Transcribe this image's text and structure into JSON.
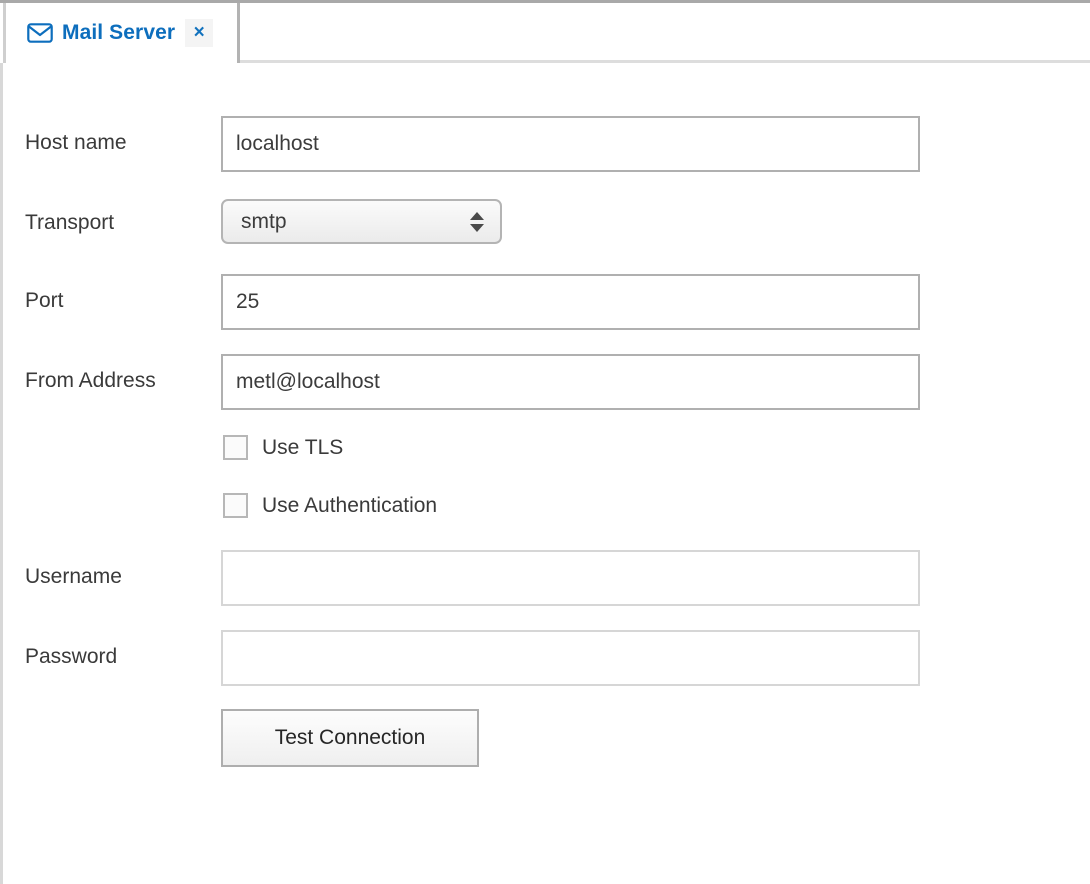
{
  "window": {
    "tab": {
      "icon": "envelope-icon",
      "title": "Mail Server",
      "close_label": "×"
    }
  },
  "form": {
    "fields": [
      {
        "label": "Host name",
        "value": "localhost",
        "placeholder": ""
      },
      {
        "label": "Port",
        "value": "25",
        "placeholder": ""
      },
      {
        "label": "From Address",
        "value": "metl@localhost",
        "placeholder": ""
      },
      {
        "label": "Username",
        "value": "",
        "placeholder": ""
      },
      {
        "label": "Password",
        "value": "",
        "placeholder": ""
      }
    ],
    "transport": {
      "label": "Transport",
      "selected": "smtp",
      "options": [
        "smtp"
      ]
    },
    "checkboxes": [
      {
        "label": "Use TLS",
        "checked": false
      },
      {
        "label": "Use Authentication",
        "checked": false
      }
    ],
    "test_button": "Test Connection"
  },
  "colors": {
    "accent": "#0d6ebd",
    "label_text": "#3a3a3a",
    "field_border": "#b0b0b0",
    "field_border_empty": "#d6d6d6"
  }
}
